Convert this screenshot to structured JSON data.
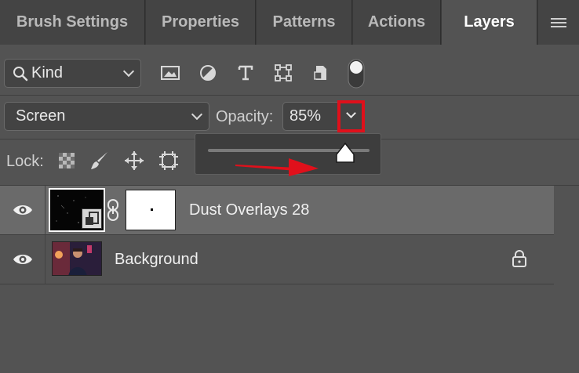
{
  "tabs": [
    {
      "label": "Brush Settings",
      "active": false
    },
    {
      "label": "Properties",
      "active": false
    },
    {
      "label": "Patterns",
      "active": false
    },
    {
      "label": "Actions",
      "active": false
    },
    {
      "label": "Layers",
      "active": true
    }
  ],
  "filter": {
    "kind_label": "Kind"
  },
  "blend": {
    "mode": "Screen",
    "opacity_label": "Opacity:",
    "opacity_value": "85%",
    "opacity_fraction": 0.85
  },
  "lock": {
    "label": "Lock:"
  },
  "layers": [
    {
      "name": "Dust Overlays 28",
      "selected": true,
      "locked": false
    },
    {
      "name": "Background",
      "selected": false,
      "locked": true
    }
  ],
  "colors": {
    "panel": "#535353",
    "highlight_box": "#e0101b",
    "arrow": "#e0101b",
    "selected_row": "#6a6a6a"
  }
}
